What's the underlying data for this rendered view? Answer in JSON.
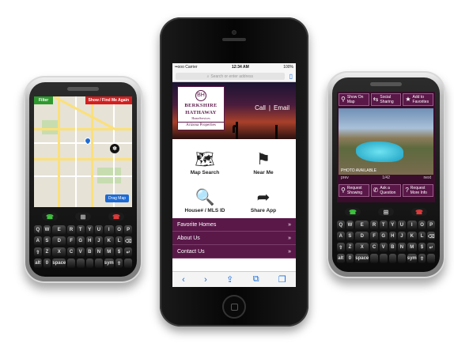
{
  "left_phone": {
    "map_left_button": "Filter",
    "map_right_button": "Show / Find Me Again",
    "map_direction_button": "Drag Map",
    "nav_left": "☎",
    "nav_mid": "⊞",
    "nav_right": "☎",
    "keys": [
      "Q",
      "W",
      "E",
      "R",
      "T",
      "Y",
      "U",
      "I",
      "O",
      "P",
      "A",
      "S",
      "D",
      "F",
      "G",
      "H",
      "J",
      "K",
      "L",
      "⌫",
      "⇧",
      "Z",
      "X",
      "C",
      "V",
      "B",
      "N",
      "M",
      "$",
      "↵",
      "alt",
      "0",
      "space",
      "",
      "",
      "",
      "",
      "sym",
      "⇧",
      ""
    ]
  },
  "iphone": {
    "status": {
      "carrier": "••ooo Carrier",
      "time": "12:34 AM",
      "battery": "100%"
    },
    "search_placeholder": "Search or enter address",
    "logo": {
      "line1": "BERKSHIRE",
      "line2": "HATHAWAY",
      "line3": "HomeServices",
      "line4": "Arizona Properties",
      "seal": "BH"
    },
    "hero_call": "Call",
    "hero_email": "Email",
    "tiles": [
      {
        "label": "Map Search",
        "icon": "map-icon",
        "glyph": "🗺"
      },
      {
        "label": "Near Me",
        "icon": "flag-icon",
        "glyph": "⚑"
      },
      {
        "label": "House# / MLS ID",
        "icon": "house-search-icon",
        "glyph": "🔍"
      },
      {
        "label": "Share App",
        "icon": "share-icon",
        "glyph": "➦"
      }
    ],
    "menu": [
      {
        "label": "Favorite Homes",
        "arrow": "»"
      },
      {
        "label": "About Us",
        "arrow": "»"
      },
      {
        "label": "Contact Us",
        "arrow": "»"
      }
    ],
    "toolbar": [
      "‹",
      "›",
      "⇪",
      "⧉",
      "❐"
    ]
  },
  "right_phone": {
    "top_buttons": [
      {
        "label": "Show On Map",
        "icon": "pin-icon",
        "glyph": "⚲"
      },
      {
        "label": "Social Sharing",
        "icon": "share-icon",
        "glyph": "⇆"
      },
      {
        "label": "Add to Favorites",
        "icon": "star-icon",
        "glyph": "★"
      }
    ],
    "photo_caption": "PHOTO AVAILABLE",
    "pager": {
      "prev": "prev",
      "count": "1/42",
      "next": "next"
    },
    "bottom_buttons": [
      {
        "label": "Request Showing",
        "icon": "pin-icon",
        "glyph": "⚲"
      },
      {
        "label": "Ask a Question",
        "icon": "phone-icon",
        "glyph": "✆"
      },
      {
        "label": "Request More Info",
        "icon": "question-icon",
        "glyph": "?"
      }
    ]
  },
  "colors": {
    "brand": "#5a1849",
    "menu": "#5a1849",
    "accent_blue": "#1a6ee0"
  }
}
